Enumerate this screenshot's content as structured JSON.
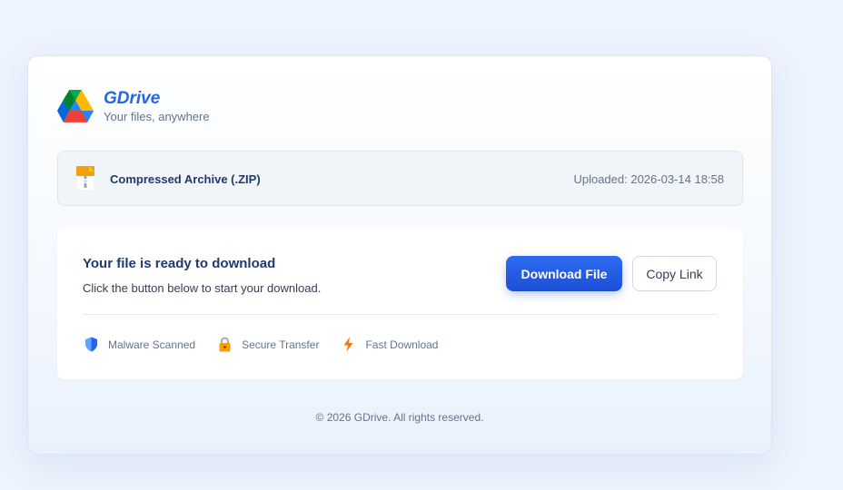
{
  "brand": {
    "name": "GDrive",
    "tagline": "Your files, anywhere"
  },
  "file": {
    "name": "Compressed Archive (.ZIP)",
    "uploaded": "Uploaded: 2026-03-14 18:58",
    "icon": "zip-file-icon"
  },
  "download": {
    "title": "Your file is ready to download",
    "subtitle": "Click the button below to start your download.",
    "download_label": "Download File",
    "copy_label": "Copy Link"
  },
  "features": [
    {
      "label": "Malware Scanned",
      "icon": "shield-icon"
    },
    {
      "label": "Secure Transfer",
      "icon": "lock-icon"
    },
    {
      "label": "Fast Download",
      "icon": "lightning-icon"
    }
  ],
  "footer": {
    "text": "© 2026 GDrive. All rights reserved."
  },
  "colors": {
    "accent": "#2563eb",
    "background": "#eef4fd",
    "heading": "#1e3a6e"
  }
}
